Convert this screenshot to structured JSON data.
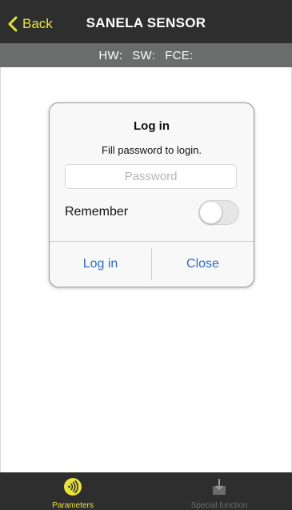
{
  "navbar": {
    "back_label": "Back",
    "title": "SANELA SENSOR"
  },
  "infobar": {
    "hw_label": "HW:",
    "sw_label": "SW:",
    "fce_label": "FCE:"
  },
  "dialog": {
    "title": "Log in",
    "message": "Fill password to login.",
    "password_placeholder": "Password",
    "password_value": "",
    "remember_label": "Remember",
    "remember_on": false,
    "login_button": "Log in",
    "close_button": "Close"
  },
  "tabbar": {
    "tabs": [
      {
        "label": "Parameters",
        "icon": "nfc-icon",
        "active": true
      },
      {
        "label": "Special function",
        "icon": "download-icon",
        "active": false
      }
    ]
  },
  "colors": {
    "accent_yellow": "#e8e23c",
    "bar_dark": "#2e2e2e",
    "infobar_gray": "#6b6d6d",
    "link_blue": "#2f6fbf"
  }
}
